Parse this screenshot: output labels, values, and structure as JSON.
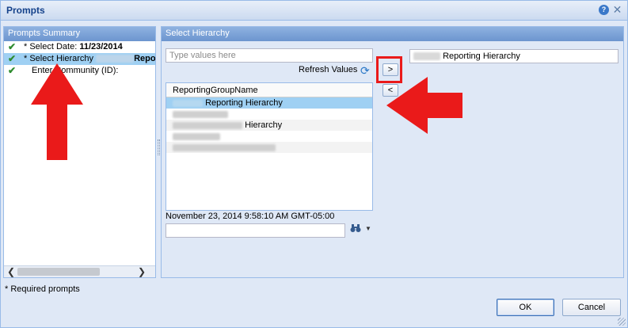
{
  "window": {
    "title": "Prompts"
  },
  "summary": {
    "header": "Prompts Summary",
    "items": [
      {
        "prefix": "* Select Date: ",
        "value": "11/23/2014"
      },
      {
        "prefix": "* Select Hierarchy ",
        "value": "Repo"
      },
      {
        "prefix": "Enter Community (ID):",
        "value": ""
      }
    ]
  },
  "hierarchy": {
    "header": "Select Hierarchy",
    "search_placeholder": "Type values here",
    "refresh_label": "Refresh Values",
    "add_label": ">",
    "remove_label": "<",
    "selected_value": "Reporting Hierarchy",
    "list_header": "ReportingGroupName",
    "list_items": [
      "Reporting Hierarchy",
      "",
      "Hierarchy",
      "",
      "",
      ""
    ],
    "timestamp": "November 23, 2014 9:58:10 AM GMT-05:00"
  },
  "footer": {
    "required_note": "* Required prompts",
    "ok_label": "OK",
    "cancel_label": "Cancel"
  },
  "colors": {
    "annotation": "#ea1a1a",
    "selection": "#9fd0f3",
    "check": "#2e8b2e"
  },
  "icons": [
    "help-icon",
    "close-icon",
    "check-icon",
    "refresh-icon",
    "binoculars-icon"
  ]
}
